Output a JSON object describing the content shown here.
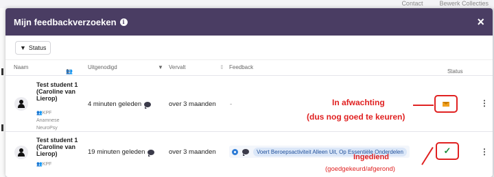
{
  "background": {
    "crumbs": [
      "Contact",
      "Bewerk Collecties"
    ]
  },
  "modal": {
    "title": "Mijn feedbackverzoeken",
    "close_label": "×",
    "filter_label": "Status",
    "columns": {
      "name": "Naam",
      "count": "1",
      "invited": "Uitgenodigd",
      "expires": "Vervalt",
      "feedback": "Feedback",
      "status": "Status"
    },
    "rows": [
      {
        "name": "Test student 1 (Caroline van Lierop)",
        "tags": [
          "KPF",
          "Anamnese",
          "NeuroPsy"
        ],
        "invited": "4 minuten geleden",
        "expires": "over 3 maanden",
        "feedback": "-",
        "status_icon": "envelope-icon"
      },
      {
        "name": "Test student 1 (Caroline van Lierop)",
        "tags": [
          "KPF"
        ],
        "invited": "19 minuten geleden",
        "expires": "over 3 maanden",
        "feedback": "Voert Beroepsactiviteit Alleen Uit, Op Essentiële Onderdelen",
        "status_icon": "check-icon"
      }
    ]
  },
  "annotations": {
    "pending_title": "In afwachting",
    "pending_sub": "(dus nog goed te keuren)",
    "submitted_title": "Ingediend",
    "submitted_sub": "(goedgekeurd/afgerond)"
  },
  "colors": {
    "header": "#4a3d63",
    "annotation": "#e02020",
    "pending": "#f0a020",
    "submitted": "#1e8e3e"
  }
}
